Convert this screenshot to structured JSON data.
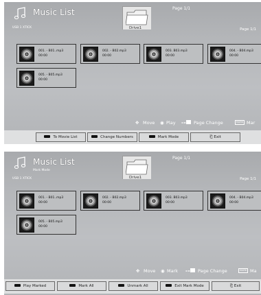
{
  "screen1": {
    "title": "Music List",
    "usb": "USB 1 XTICK",
    "page_top": "Page 1/1",
    "page_right": "Page 1/1",
    "drive": "Drive1",
    "tiles": [
      {
        "name": "001. - B01..mp3",
        "duration": "00:00"
      },
      {
        "name": "002. - B02.mp3",
        "duration": "00:00"
      },
      {
        "name": "003. B03.mp3",
        "duration": "00:00"
      },
      {
        "name": "004. - B04.mp3",
        "duration": "00:00"
      },
      {
        "name": "005. - B05.mp3",
        "duration": "00:00"
      }
    ],
    "hints": {
      "move": "Move",
      "play": "Play",
      "page_change": "Page Change",
      "mark": "Mar"
    },
    "buttons": [
      "To Movie List",
      "Change Numbers",
      "Mark Mode",
      "Exit"
    ]
  },
  "screen2": {
    "title": "Music List",
    "subtitle": "Mark Mode",
    "usb": "USB 1 XTICK",
    "page_top": "Page 1/1",
    "page_right": "Page 1/1",
    "drive": "Drive1",
    "tiles": [
      {
        "name": "001. - B01..mp3",
        "duration": "00:00"
      },
      {
        "name": "002. - B02.mp3",
        "duration": "00:00"
      },
      {
        "name": "003. B03.mp3",
        "duration": "00:00"
      },
      {
        "name": "004. - B04.mp3",
        "duration": "00:00"
      },
      {
        "name": "005. - B05.mp3",
        "duration": "00:00"
      }
    ],
    "hints": {
      "move": "Move",
      "mark": "Mark",
      "page_change": "Page Change",
      "mark_key": "Ma"
    },
    "buttons": [
      "Play Marked",
      "Mark All",
      "Unmark All",
      "Exit Mark Mode",
      "Exit"
    ]
  },
  "icons": {
    "key_mark": "MARK",
    "page_key": "P"
  }
}
